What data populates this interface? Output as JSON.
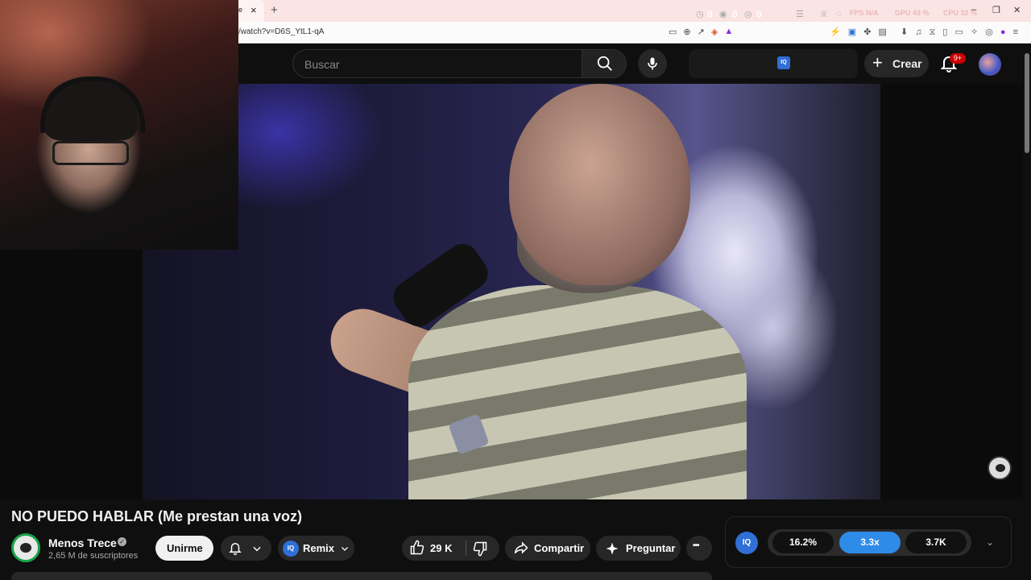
{
  "browser": {
    "tab_fragment": "e",
    "tab_close": "×",
    "new_tab": "+",
    "url": "/watch?v=D6S_YtL1-qA",
    "perf": [
      {
        "label": "FPS",
        "value": "N/A"
      },
      {
        "label": "GPU",
        "value": "43 %"
      },
      {
        "label": "CPU",
        "value": "32 %"
      }
    ],
    "window_controls": [
      "–",
      "❐",
      "✕"
    ]
  },
  "header": {
    "search_placeholder": "Buscar",
    "stats": [
      "0",
      "0",
      "0"
    ],
    "create_label": "Crear",
    "notifications_badge": "9+"
  },
  "video": {
    "title": "NO PUEDO HABLAR (Me prestan una voz)"
  },
  "channel": {
    "name": "Menos Trece",
    "verified_mark": "✓",
    "subscribers": "2,65 M de suscriptores"
  },
  "actions": {
    "join": "Unirme",
    "remix": "Remix",
    "likes": "29 K",
    "share": "Compartir",
    "ask": "Preguntar",
    "more": "•••"
  },
  "iq_panel": {
    "logo": "IQ",
    "chips": [
      "16.2%",
      "3.3x",
      "3.7K"
    ],
    "active_chip": 1
  },
  "colors": {
    "accent_blue": "#2f8be8",
    "badge_red": "#cc0000",
    "channel_ring": "#1aa34a"
  }
}
